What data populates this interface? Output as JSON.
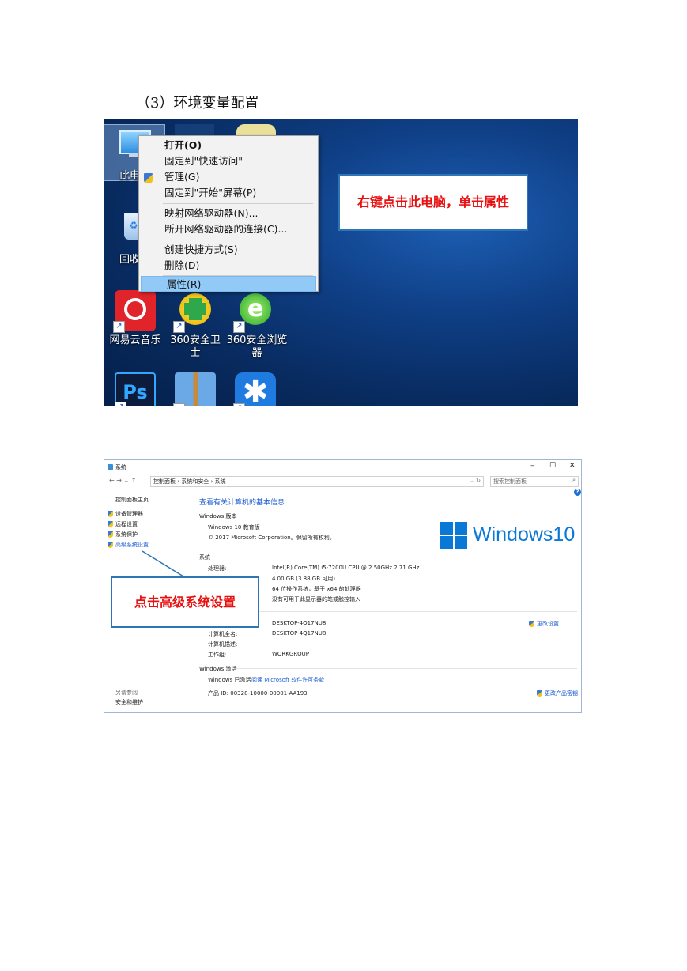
{
  "heading": "（3）环境变量配置",
  "desktop": {
    "icons": {
      "this_pc": "此电",
      "recycle_bin": "回收",
      "netease": "网易云音乐",
      "safe360": "360安全卫士",
      "browser360": "360安全浏览器",
      "ps": "Ps"
    },
    "context_menu": {
      "open": "打开(O)",
      "pin_quick": "固定到\"快速访问\"",
      "manage": "管理(G)",
      "pin_start": "固定到\"开始\"屏幕(P)",
      "map_drive": "映射网络驱动器(N)...",
      "disconnect_drive": "断开网络驱动器的连接(C)...",
      "create_shortcut": "创建快捷方式(S)",
      "delete": "删除(D)",
      "properties": "属性(R)"
    },
    "callout": "右键点击此电脑，单击属性"
  },
  "system_window": {
    "title": "系统",
    "controls": {
      "minimize": "–",
      "maximize": "☐",
      "close": "✕"
    },
    "breadcrumb": "控制面板  ›  系统和安全  ›  系统",
    "search_placeholder": "搜索控制面板",
    "sidebar": {
      "home": "控制面板主页",
      "device_manager": "设备管理器",
      "remote": "远程设置",
      "protection": "系统保护",
      "advanced": "高级系统设置",
      "see_also": "另请参阅",
      "security": "安全和维护"
    },
    "main_title": "查看有关计算机的基本信息",
    "edition_header": "Windows 版本",
    "edition": "Windows 10 教育版",
    "copyright": "© 2017 Microsoft Corporation。保留所有权利。",
    "logo_text": "Windows10",
    "system_header": "系统",
    "processor_label": "处理器:",
    "processor": "Intel(R) Core(TM) i5-7200U CPU @ 2.50GHz   2.71 GHz",
    "ram": "4.00 GB (3.88 GB 可用)",
    "system_type": "64 位操作系统，基于 x64 的处理器",
    "pen_touch": "没有可用于此显示器的笔或触控输入",
    "computer_name": "DESKTOP-4Q17NU8",
    "change_settings": "更改设置",
    "full_name_label": "计算机全名:",
    "full_name": "DESKTOP-4Q17NU8",
    "description_label": "计算机描述:",
    "workgroup_label": "工作组:",
    "workgroup": "WORKGROUP",
    "activation_header": "Windows 激活",
    "activated": "Windows 已激活",
    "license_link": "阅读 Microsoft 软件许可条款",
    "product_id": "产品 ID: 00328-10000-00001-AA193",
    "change_key": "更改产品密钥",
    "help": "?"
  },
  "callout2": "点击高级系统设置"
}
